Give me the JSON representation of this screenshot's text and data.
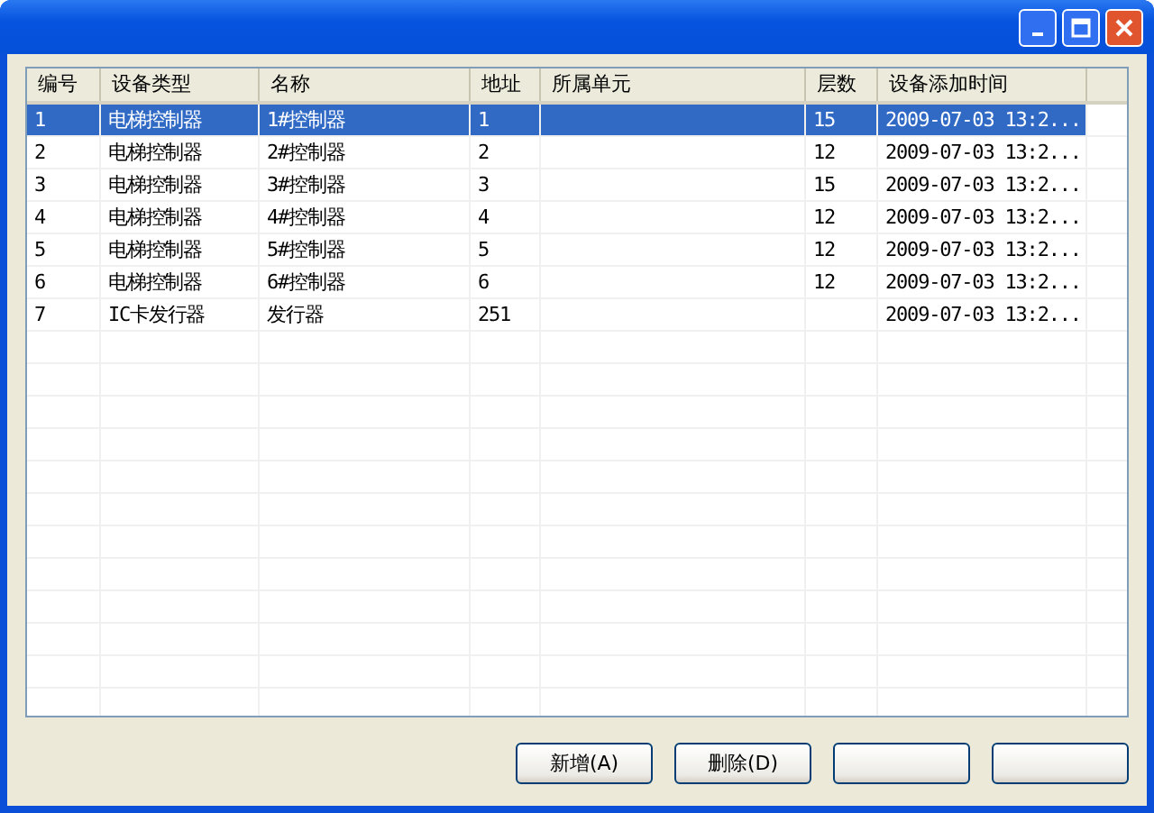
{
  "table": {
    "columns": [
      "编号",
      "设备类型",
      "名称",
      "地址",
      "所属单元",
      "层数",
      "设备添加时间"
    ],
    "rows": [
      {
        "cells": [
          "1",
          "电梯控制器",
          "1#控制器",
          "1",
          "",
          "15",
          "2009-07-03 13:2..."
        ],
        "selected": true
      },
      {
        "cells": [
          "2",
          "电梯控制器",
          "2#控制器",
          "2",
          "",
          "12",
          "2009-07-03 13:2..."
        ],
        "selected": false
      },
      {
        "cells": [
          "3",
          "电梯控制器",
          "3#控制器",
          "3",
          "",
          "15",
          "2009-07-03 13:2..."
        ],
        "selected": false
      },
      {
        "cells": [
          "4",
          "电梯控制器",
          "4#控制器",
          "4",
          "",
          "12",
          "2009-07-03 13:2..."
        ],
        "selected": false
      },
      {
        "cells": [
          "5",
          "电梯控制器",
          "5#控制器",
          "5",
          "",
          "12",
          "2009-07-03 13:2..."
        ],
        "selected": false
      },
      {
        "cells": [
          "6",
          "电梯控制器",
          "6#控制器",
          "6",
          "",
          "12",
          "2009-07-03 13:2..."
        ],
        "selected": false
      },
      {
        "cells": [
          "7",
          "IC卡发行器",
          "发行器",
          "251",
          "",
          "",
          "2009-07-03 13:2..."
        ],
        "selected": false
      }
    ]
  },
  "buttons": [
    {
      "label": "新增(A)"
    },
    {
      "label": "删除(D)"
    }
  ]
}
